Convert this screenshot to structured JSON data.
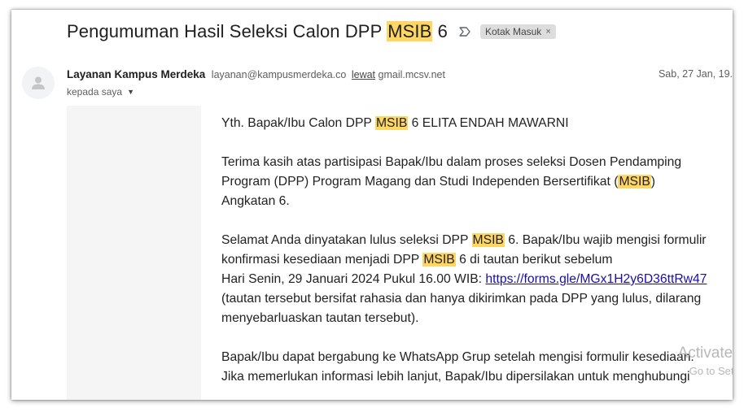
{
  "email": {
    "subject_prefix": "Pengumuman Hasil Seleksi Calon DPP ",
    "subject_highlight": "MSIB",
    "subject_suffix": " 6",
    "label": "Kotak Masuk",
    "label_remove": "×",
    "sender_name": "Layanan Kampus Merdeka",
    "sender_email": "layanan@kampusmerdeka.co",
    "via_label": "lewat",
    "via_domain": "gmail.mcsv.net",
    "date": "Sab, 27 Jan, 19.",
    "to_label": "kepada saya",
    "icons": {
      "avatar": "person-avatar-icon",
      "importance": "importance-marker-icon",
      "to_dropdown": "chevron-down-icon"
    }
  },
  "body": {
    "greeting_pre": "Yth. Bapak/Ibu Calon DPP ",
    "greeting_hl": "MSIB",
    "greeting_post": " 6 ELITA ENDAH MAWARNI",
    "p1_line1": "Terima kasih atas partisipasi Bapak/Ibu dalam proses seleksi Dosen Pendamping",
    "p1_line2_pre": "Program (DPP) Program Magang dan Studi Independen Bersertifikat (",
    "p1_line2_hl": "MSIB",
    "p1_line2_post": ")",
    "p1_line3": "Angkatan 6.",
    "p2_line1_pre": "Selamat Anda dinyatakan lulus seleksi DPP ",
    "p2_line1_hl": "MSIB",
    "p2_line1_post": " 6. Bapak/Ibu wajib mengisi formulir",
    "p2_line2_pre": "konfirmasi kesediaan menjadi DPP ",
    "p2_line2_hl": "MSIB",
    "p2_line2_post": " 6 di tautan berikut sebelum",
    "p2_line3": "Hari Senin, 29 Januari 2024 Pukul 16.00 WIB: ",
    "p2_link": "https://forms.gle/MGx1H2y6D36ttRw47",
    "p2_line4": "(tautan tersebut bersifat rahasia dan hanya dikirimkan pada DPP yang lulus, dilarang",
    "p2_line5": "menyebarluaskan tautan tersebut).",
    "p3_line1": "Bapak/Ibu dapat bergabung ke WhatsApp Grup setelah mengisi formulir kesediaan.",
    "p3_line2": "Jika memerlukan informasi lebih lanjut, Bapak/Ibu dipersilakan untuk menghubungi"
  },
  "watermark": {
    "title": "Activate",
    "subtitle": "Go to Setti"
  },
  "colors": {
    "highlight": "#fdd663",
    "link": "#1a0dab",
    "chip_bg": "#dddddd"
  }
}
